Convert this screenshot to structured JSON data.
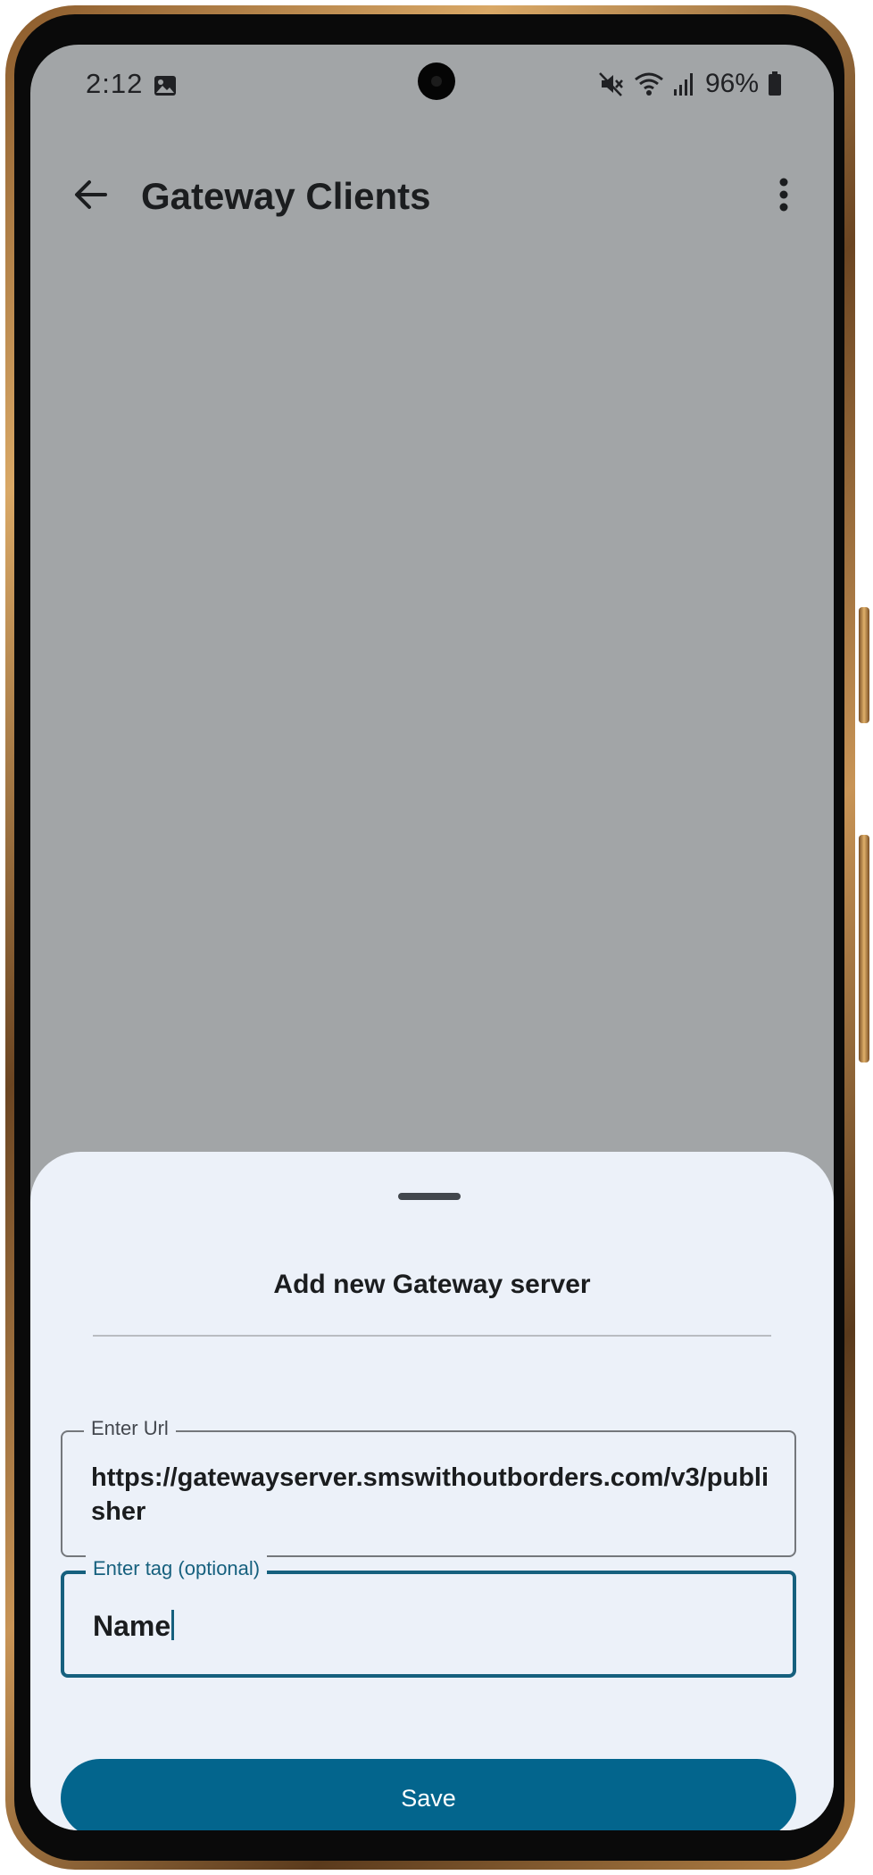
{
  "status_bar": {
    "time": "2:12",
    "battery_percent": "96%",
    "icons": [
      "image-icon",
      "mute-icon",
      "wifi-icon",
      "signal-icon",
      "battery-icon"
    ]
  },
  "app_bar": {
    "title": "Gateway Clients",
    "back_icon": "arrow-back-icon",
    "menu_icon": "more-vert-icon"
  },
  "sheet": {
    "title": "Add new Gateway server",
    "url_field": {
      "label": "Enter Url",
      "value": "https://gatewayserver.smswithoutborders.com/v3/publisher"
    },
    "tag_field": {
      "label": "Enter tag (optional)",
      "value": "Name"
    },
    "save_label": "Save"
  },
  "colors": {
    "scrim": "#a2a5a7",
    "sheet_bg": "#ecf1f9",
    "accent": "#16607e",
    "button": "#03658d"
  }
}
